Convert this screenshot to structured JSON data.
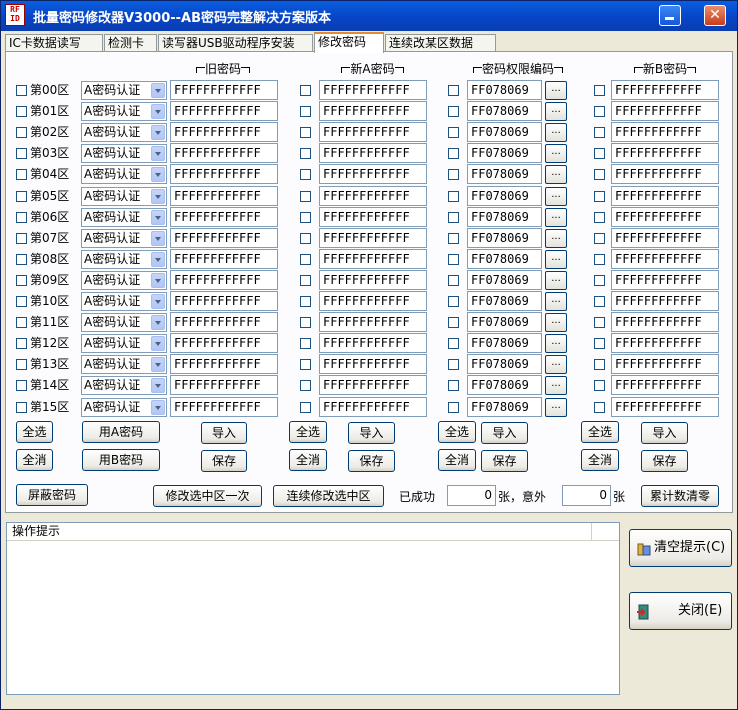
{
  "window": {
    "title": "批量密码修改器V3000--AB密码完整解决方案版本",
    "icon_text": "RF ID",
    "minimize_icon": "minimize-icon",
    "close_icon": "close-icon",
    "close_glyph": "✕"
  },
  "tabs": [
    {
      "label": "IC卡数据读写",
      "active": false
    },
    {
      "label": "检测卡",
      "active": false
    },
    {
      "label": "读写器USB驱动程序安装",
      "active": false
    },
    {
      "label": "修改密码",
      "active": true
    },
    {
      "label": "连续改某区数据",
      "active": false
    }
  ],
  "columns": {
    "old_password": "旧密码",
    "new_a_password": "新A密码",
    "access_bits": "密码权限编码",
    "new_b_password": "新B密码"
  },
  "sectors": [
    {
      "label": "第00区",
      "auth": "A密码认证",
      "old": "FFFFFFFFFFFF",
      "new_a": "FFFFFFFFFFFF",
      "access": "FF078069",
      "new_b": "FFFFFFFFFFFF"
    },
    {
      "label": "第01区",
      "auth": "A密码认证",
      "old": "FFFFFFFFFFFF",
      "new_a": "FFFFFFFFFFFF",
      "access": "FF078069",
      "new_b": "FFFFFFFFFFFF"
    },
    {
      "label": "第02区",
      "auth": "A密码认证",
      "old": "FFFFFFFFFFFF",
      "new_a": "FFFFFFFFFFFF",
      "access": "FF078069",
      "new_b": "FFFFFFFFFFFF"
    },
    {
      "label": "第03区",
      "auth": "A密码认证",
      "old": "FFFFFFFFFFFF",
      "new_a": "FFFFFFFFFFFF",
      "access": "FF078069",
      "new_b": "FFFFFFFFFFFF"
    },
    {
      "label": "第04区",
      "auth": "A密码认证",
      "old": "FFFFFFFFFFFF",
      "new_a": "FFFFFFFFFFFF",
      "access": "FF078069",
      "new_b": "FFFFFFFFFFFF"
    },
    {
      "label": "第05区",
      "auth": "A密码认证",
      "old": "FFFFFFFFFFFF",
      "new_a": "FFFFFFFFFFFF",
      "access": "FF078069",
      "new_b": "FFFFFFFFFFFF"
    },
    {
      "label": "第06区",
      "auth": "A密码认证",
      "old": "FFFFFFFFFFFF",
      "new_a": "FFFFFFFFFFFF",
      "access": "FF078069",
      "new_b": "FFFFFFFFFFFF"
    },
    {
      "label": "第07区",
      "auth": "A密码认证",
      "old": "FFFFFFFFFFFF",
      "new_a": "FFFFFFFFFFFF",
      "access": "FF078069",
      "new_b": "FFFFFFFFFFFF"
    },
    {
      "label": "第08区",
      "auth": "A密码认证",
      "old": "FFFFFFFFFFFF",
      "new_a": "FFFFFFFFFFFF",
      "access": "FF078069",
      "new_b": "FFFFFFFFFFFF"
    },
    {
      "label": "第09区",
      "auth": "A密码认证",
      "old": "FFFFFFFFFFFF",
      "new_a": "FFFFFFFFFFFF",
      "access": "FF078069",
      "new_b": "FFFFFFFFFFFF"
    },
    {
      "label": "第10区",
      "auth": "A密码认证",
      "old": "FFFFFFFFFFFF",
      "new_a": "FFFFFFFFFFFF",
      "access": "FF078069",
      "new_b": "FFFFFFFFFFFF"
    },
    {
      "label": "第11区",
      "auth": "A密码认证",
      "old": "FFFFFFFFFFFF",
      "new_a": "FFFFFFFFFFFF",
      "access": "FF078069",
      "new_b": "FFFFFFFFFFFF"
    },
    {
      "label": "第12区",
      "auth": "A密码认证",
      "old": "FFFFFFFFFFFF",
      "new_a": "FFFFFFFFFFFF",
      "access": "FF078069",
      "new_b": "FFFFFFFFFFFF"
    },
    {
      "label": "第13区",
      "auth": "A密码认证",
      "old": "FFFFFFFFFFFF",
      "new_a": "FFFFFFFFFFFF",
      "access": "FF078069",
      "new_b": "FFFFFFFFFFFF"
    },
    {
      "label": "第14区",
      "auth": "A密码认证",
      "old": "FFFFFFFFFFFF",
      "new_a": "FFFFFFFFFFFF",
      "access": "FF078069",
      "new_b": "FFFFFFFFFFFF"
    },
    {
      "label": "第15区",
      "auth": "A密码认证",
      "old": "FFFFFFFFFFFF",
      "new_a": "FFFFFFFFFFFF",
      "access": "FF078069",
      "new_b": "FFFFFFFFFFFF"
    }
  ],
  "access_button_label": "...",
  "buttons": {
    "select_all": "全选",
    "deselect_all": "全消",
    "use_a_password": "用A密码",
    "use_b_password": "用B密码",
    "import": "导入",
    "save": "保存",
    "hide_password": "屏蔽密码",
    "modify_selected_once": "修改选中区一次",
    "continuous_modify": "连续修改选中区",
    "reset_counters": "累计数清零",
    "clear_log": "清空提示(C)",
    "close": "关闭(E)"
  },
  "counters": {
    "success_label": "已成功",
    "success_value": "0",
    "unit_unexpected": "张，意外",
    "fail_value": "0",
    "unit": "张"
  },
  "log": {
    "header": "操作提示"
  },
  "colors": {
    "titlebar": "#0a53d6",
    "window_bg": "#ece9d8",
    "active_tab_accent": "#e68b2c"
  }
}
